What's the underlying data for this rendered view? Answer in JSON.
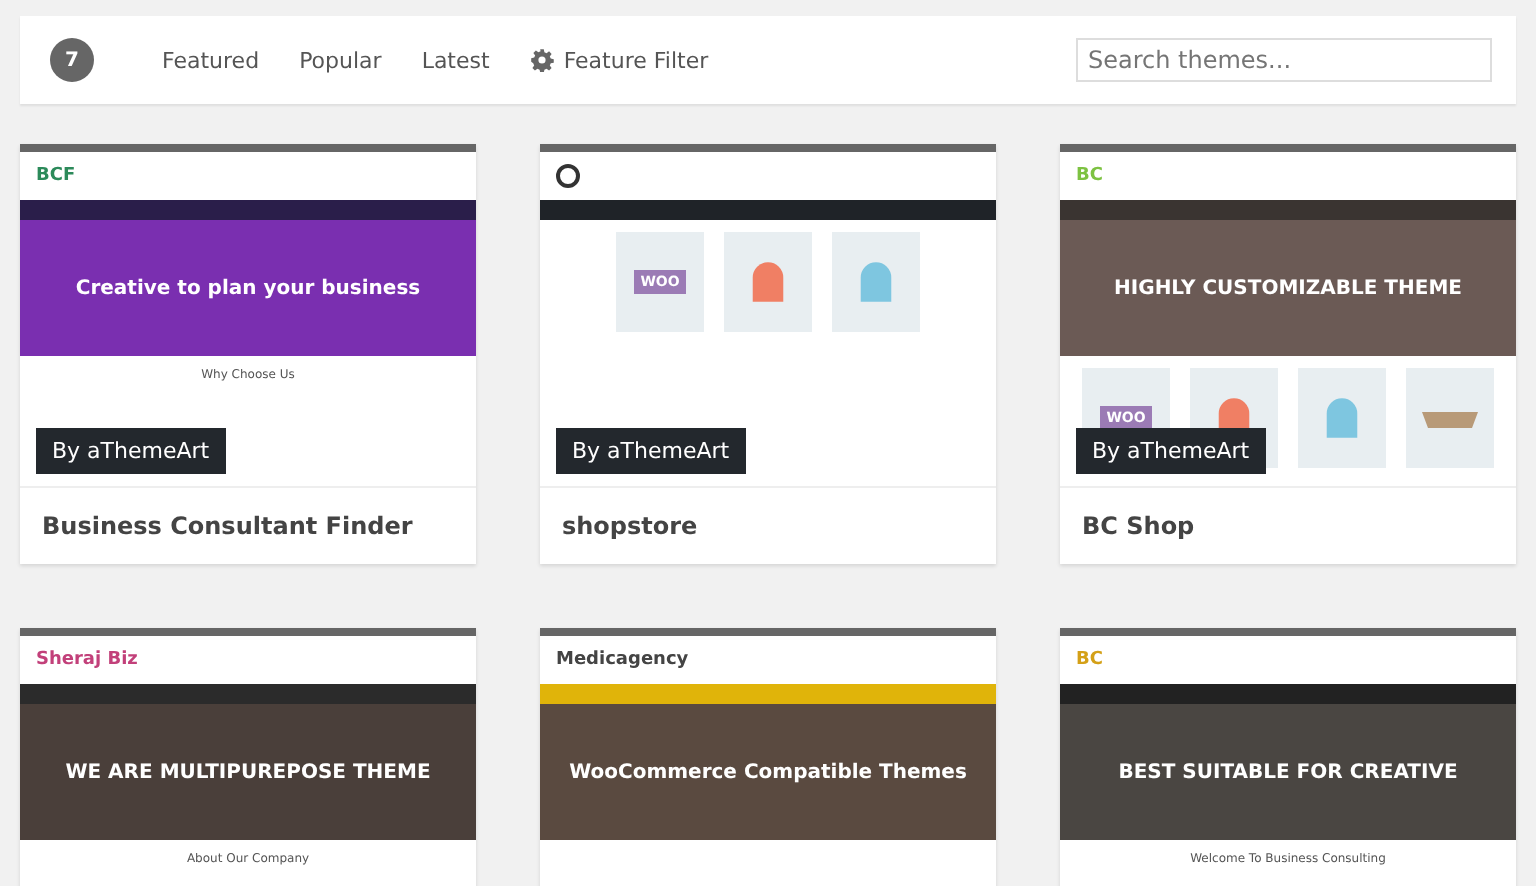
{
  "header": {
    "count": "7",
    "filters": [
      {
        "label": "Featured",
        "kind": "link"
      },
      {
        "label": "Popular",
        "kind": "link"
      },
      {
        "label": "Latest",
        "kind": "link"
      },
      {
        "label": "Feature Filter",
        "kind": "gear"
      }
    ],
    "search": {
      "placeholder": "Search themes..."
    }
  },
  "themes": [
    {
      "name": "Business Consultant Finder",
      "author_badge": "By aThemeArt",
      "preview": {
        "logo": {
          "text": "BCF",
          "color": "#2c8a5a"
        },
        "nav": {
          "color": "#2a1e4a"
        },
        "hero": {
          "headline": "Creative to plan your business",
          "color": "#7a2fb0"
        },
        "section_title": "Why Choose Us"
      }
    },
    {
      "name": "shopstore",
      "author_badge": "By aThemeArt",
      "preview": {
        "nav": {
          "color": "#1f2328"
        },
        "products": [
          {
            "kind": "woo",
            "label": "WOO"
          },
          {
            "kind": "hat",
            "color": "#f07f64"
          },
          {
            "kind": "hat",
            "color": "#7ec6e0"
          }
        ]
      }
    },
    {
      "name": "BC Shop",
      "author_badge": "By aThemeArt",
      "preview": {
        "logo": {
          "text": "BC",
          "color": "#7dc242"
        },
        "nav": {
          "color": "#3a3431"
        },
        "hero": {
          "headline": "HIGHLY CUSTOMIZABLE THEME",
          "color": "#6b5a55"
        },
        "products": [
          {
            "kind": "woo",
            "label": "WOO"
          },
          {
            "kind": "hat",
            "color": "#f07f64"
          },
          {
            "kind": "hat",
            "color": "#7ec6e0"
          },
          {
            "kind": "tray",
            "color": "#b89a78"
          }
        ]
      }
    },
    {
      "preview": {
        "logo": {
          "text": "Sheraj Biz",
          "color": "#c2407a"
        },
        "nav": {
          "color": "#2b2b2b"
        },
        "hero": {
          "headline": "WE ARE MULTIPUREPOSE THEME",
          "color": "#4a3f3a"
        },
        "section_title": "About Our Company"
      }
    },
    {
      "preview": {
        "logo": {
          "text": "Medicagency",
          "color": "#444444"
        },
        "nav": {
          "color": "#e0b40a"
        },
        "hero": {
          "headline": "WooCommerce Compatible Themes",
          "color": "#5a4a40"
        }
      }
    },
    {
      "preview": {
        "logo": {
          "text": "BC",
          "color": "#d4a017"
        },
        "nav": {
          "color": "#222222"
        },
        "hero": {
          "headline": "BEST SUITABLE FOR CREATIVE",
          "color": "#4a4642"
        },
        "section_title": "Welcome To Business Consulting"
      }
    }
  ]
}
